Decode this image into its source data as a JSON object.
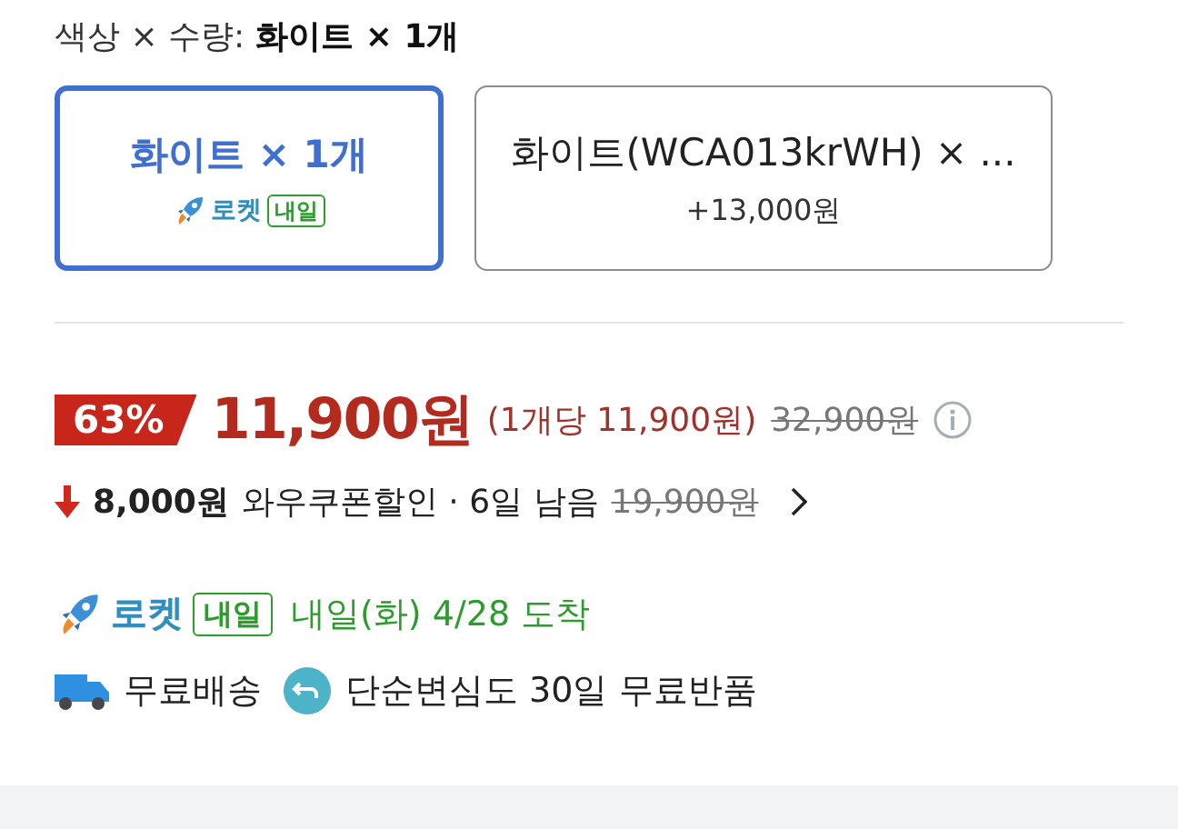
{
  "option_header": {
    "label": "색상 × 수량:",
    "value": "화이트 × 1개"
  },
  "options": [
    {
      "label": "화이트 × 1개",
      "selected": true,
      "badge": {
        "brand": "로켓",
        "tag": "내일"
      }
    },
    {
      "label": "화이트(WCA013krWH) × ...",
      "selected": false,
      "extra_price": "+13,000원"
    }
  ],
  "price": {
    "discount": "63%",
    "sale_price": "11,900원",
    "unit_price": "(1개당 11,900원)",
    "original_price": "32,900원"
  },
  "coupon": {
    "amount": "8,000원",
    "label": "와우쿠폰할인 · 6일 남음",
    "final_price": "19,900원"
  },
  "delivery": {
    "brand": "로켓",
    "tag": "내일",
    "arrival": "내일(화) 4/28 도착"
  },
  "benefits": [
    {
      "kind": "shipping",
      "label": "무료배송"
    },
    {
      "kind": "return",
      "label": "단순변심도 30일 무료반품"
    }
  ]
}
